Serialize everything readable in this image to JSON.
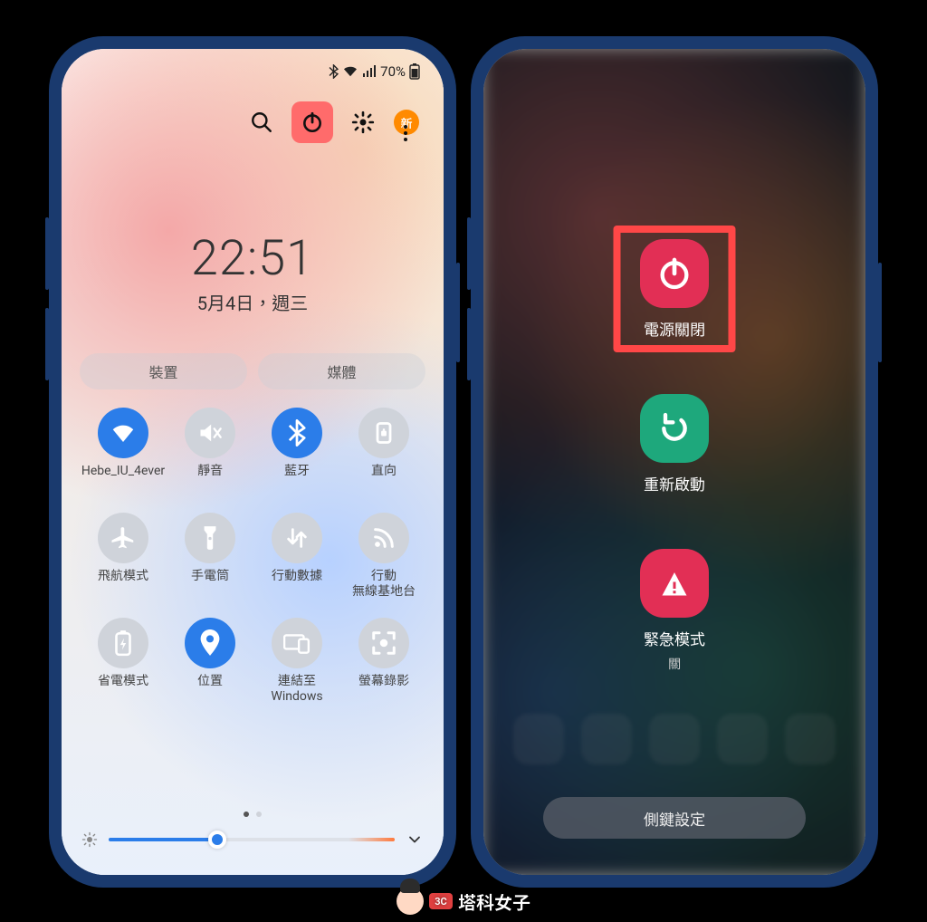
{
  "status": {
    "battery_pct": "70%"
  },
  "top": {
    "new_badge": "新"
  },
  "clock": {
    "time": "22:51",
    "date": "5月4日，週三"
  },
  "pills": {
    "devices": "裝置",
    "media": "媒體"
  },
  "tiles": [
    {
      "id": "wifi",
      "label": "Hebe_IU_4ever",
      "on": true,
      "icon": "wifi-icon"
    },
    {
      "id": "mute",
      "label": "靜音",
      "on": false,
      "icon": "mute-icon"
    },
    {
      "id": "bluetooth",
      "label": "藍牙",
      "on": true,
      "icon": "bluetooth-icon"
    },
    {
      "id": "rotation",
      "label": "直向",
      "on": false,
      "icon": "rotation-lock-icon"
    },
    {
      "id": "airplane",
      "label": "飛航模式",
      "on": false,
      "icon": "airplane-icon"
    },
    {
      "id": "flashlight",
      "label": "手電筒",
      "on": false,
      "icon": "flashlight-icon"
    },
    {
      "id": "data",
      "label": "行動數據",
      "on": false,
      "icon": "data-swap-icon"
    },
    {
      "id": "hotspot",
      "label": "行動\n無線基地台",
      "on": false,
      "icon": "hotspot-rss-icon"
    },
    {
      "id": "battery",
      "label": "省電模式",
      "on": false,
      "icon": "battery-saver-icon"
    },
    {
      "id": "location",
      "label": "位置",
      "on": true,
      "icon": "location-icon"
    },
    {
      "id": "link",
      "label": "連結至\nWindows",
      "on": false,
      "icon": "link-windows-icon"
    },
    {
      "id": "record",
      "label": "螢幕錄影",
      "on": false,
      "icon": "screen-record-icon"
    }
  ],
  "brightness_pct": 38,
  "power_menu": {
    "power_off": "電源關閉",
    "restart": "重新啟動",
    "emergency": "緊急模式",
    "emergency_state": "關",
    "side_key": "側鍵設定"
  },
  "watermark": "塔科女子",
  "watermark_chip": "3C"
}
